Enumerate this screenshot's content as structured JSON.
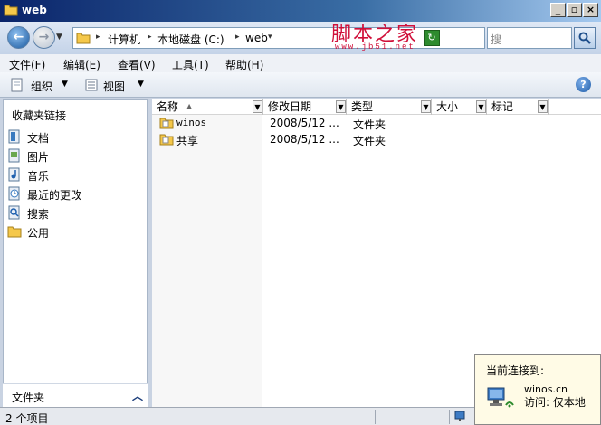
{
  "window": {
    "title": "web"
  },
  "address": {
    "crumbs": [
      "计算机",
      "本地磁盘 (C:)",
      "web"
    ],
    "search_placeholder": "搜"
  },
  "watermark": {
    "text": "脚本之家",
    "url": "www.jb51.net"
  },
  "menu": [
    "文件(F)",
    "编辑(E)",
    "查看(V)",
    "工具(T)",
    "帮助(H)"
  ],
  "toolbar": {
    "organize_label": "组织",
    "views_label": "视图"
  },
  "sidebar": {
    "favorites_title": "收藏夹链接",
    "items": [
      {
        "label": "文档",
        "icon": "documents-icon"
      },
      {
        "label": "图片",
        "icon": "pictures-icon"
      },
      {
        "label": "音乐",
        "icon": "music-icon"
      },
      {
        "label": "最近的更改",
        "icon": "recent-changes-icon"
      },
      {
        "label": "搜索",
        "icon": "search-icon"
      },
      {
        "label": "公用",
        "icon": "public-folder-icon"
      }
    ],
    "folders_label": "文件夹"
  },
  "columns": [
    "名称",
    "修改日期",
    "类型",
    "大小",
    "标记"
  ],
  "files": [
    {
      "name": "winos",
      "modified": "2008/5/12 ...",
      "type": "文件夹"
    },
    {
      "name": "共享",
      "modified": "2008/5/12 ...",
      "type": "文件夹"
    }
  ],
  "status": {
    "count": "2 个项目"
  },
  "popup": {
    "title": "当前连接到:",
    "network": "winos.cn",
    "access": "访问: 仅本地"
  },
  "colors": {
    "title_bar": "#0a246a",
    "watermark": "#d0103a",
    "popup_bg": "#fffbe6"
  }
}
